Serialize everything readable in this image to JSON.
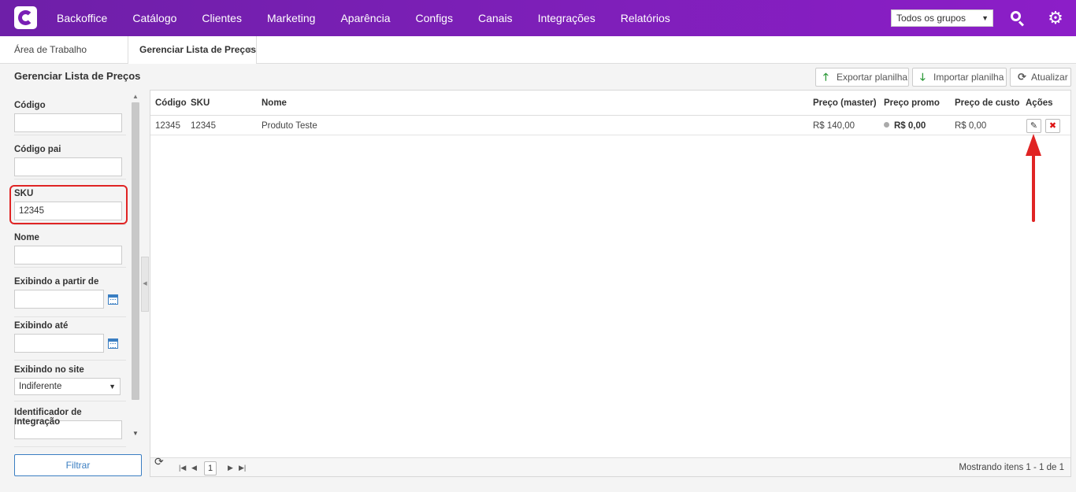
{
  "nav": {
    "items": [
      "Backoffice",
      "Catálogo",
      "Clientes",
      "Marketing",
      "Aparência",
      "Configs",
      "Canais",
      "Integrações",
      "Relatórios"
    ],
    "group_select": "Todos os grupos",
    "brand_color": "#7a1fb5"
  },
  "tabs": {
    "work": "Área de Trabalho",
    "price": "Gerenciar Lista de Preços",
    "close": "×"
  },
  "page": {
    "title": "Gerenciar Lista de Preços",
    "export": "Exportar planilha",
    "import": "Importar planilha",
    "refresh": "Atualizar"
  },
  "filters": {
    "codigo": {
      "label": "Código",
      "value": ""
    },
    "codigo_pai": {
      "label": "Código pai",
      "value": ""
    },
    "sku": {
      "label": "SKU",
      "value": "12345"
    },
    "nome": {
      "label": "Nome",
      "value": ""
    },
    "de": {
      "label": "Exibindo a partir de",
      "value": ""
    },
    "ate": {
      "label": "Exibindo até",
      "value": ""
    },
    "site": {
      "label": "Exibindo no site",
      "value": "Indiferente"
    },
    "integ": {
      "label": "Identificador de Integração",
      "value": ""
    },
    "button": "Filtrar"
  },
  "grid": {
    "headers": {
      "codigo": "Código",
      "sku": "SKU",
      "nome": "Nome",
      "preco_master": "Preço (master)",
      "preco_promo": "Preço promo",
      "preco_custo": "Preço de custo",
      "acoes": "Ações"
    },
    "rows": [
      {
        "codigo": "12345",
        "sku": "12345",
        "nome": "Produto Teste",
        "preco_master": "R$ 140,00",
        "preco_promo": "R$ 0,00",
        "preco_custo": "R$ 0,00"
      }
    ],
    "pager": {
      "page": "1",
      "info": "Mostrando itens 1 - 1 de 1"
    }
  },
  "icons": {
    "edit": "✎",
    "delete": "✖",
    "export": "🡑",
    "import": "🡓",
    "refresh": "⟳",
    "gear": "⚙"
  },
  "annotation_color": "#e02424"
}
